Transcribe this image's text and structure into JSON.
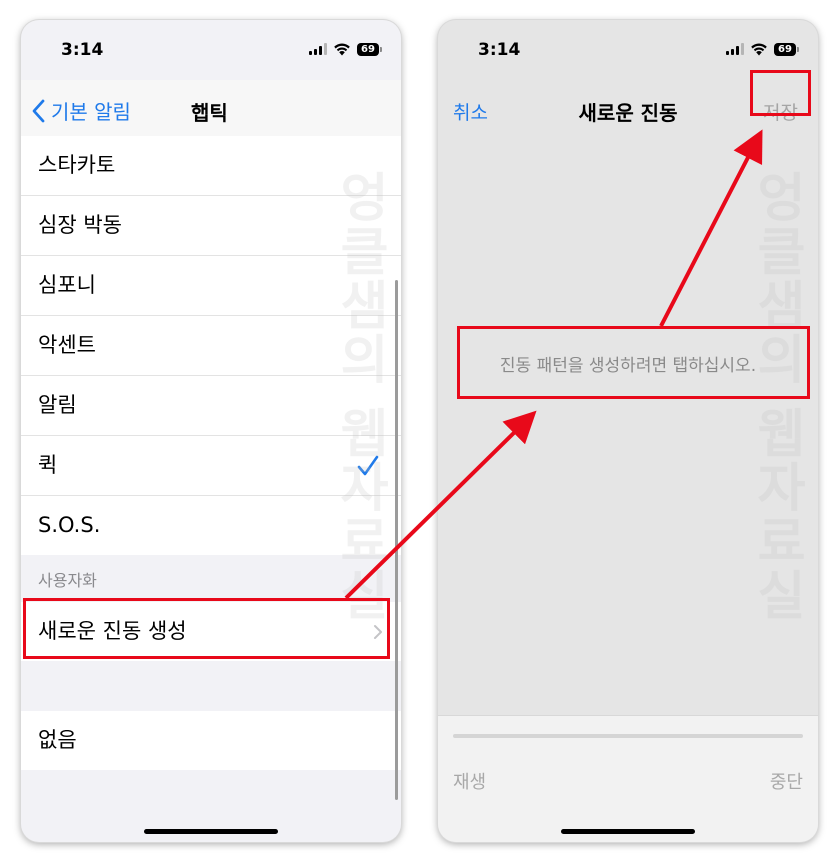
{
  "left_screen": {
    "status": {
      "time": "3:14",
      "battery": "69"
    },
    "nav": {
      "back_label": "기본 알림",
      "title": "햅틱"
    },
    "items": [
      {
        "label": "스타카토"
      },
      {
        "label": "심장 박동"
      },
      {
        "label": "심포니"
      },
      {
        "label": "악센트"
      },
      {
        "label": "알림"
      },
      {
        "label": "퀵",
        "selected": true
      },
      {
        "label": "S.O.S."
      }
    ],
    "custom_section": {
      "header": "사용자화",
      "create_label": "새로운 진동 생성"
    },
    "none_label": "없음",
    "watermark": "엉클샘의 웹자료실"
  },
  "right_screen": {
    "status": {
      "time": "3:14",
      "battery": "69"
    },
    "nav": {
      "cancel_label": "취소",
      "title": "새로운 진동",
      "save_label": "저장"
    },
    "hint": "진동 패턴을 생성하려면 탭하십시오.",
    "controls": {
      "play_label": "재생",
      "stop_label": "중단",
      "progress": 0
    },
    "watermark": "엉클샘의 웹자료실"
  },
  "colors": {
    "accent": "#1f7aea",
    "annotation": "#e8091a",
    "disabled": "#a5a5a5"
  }
}
